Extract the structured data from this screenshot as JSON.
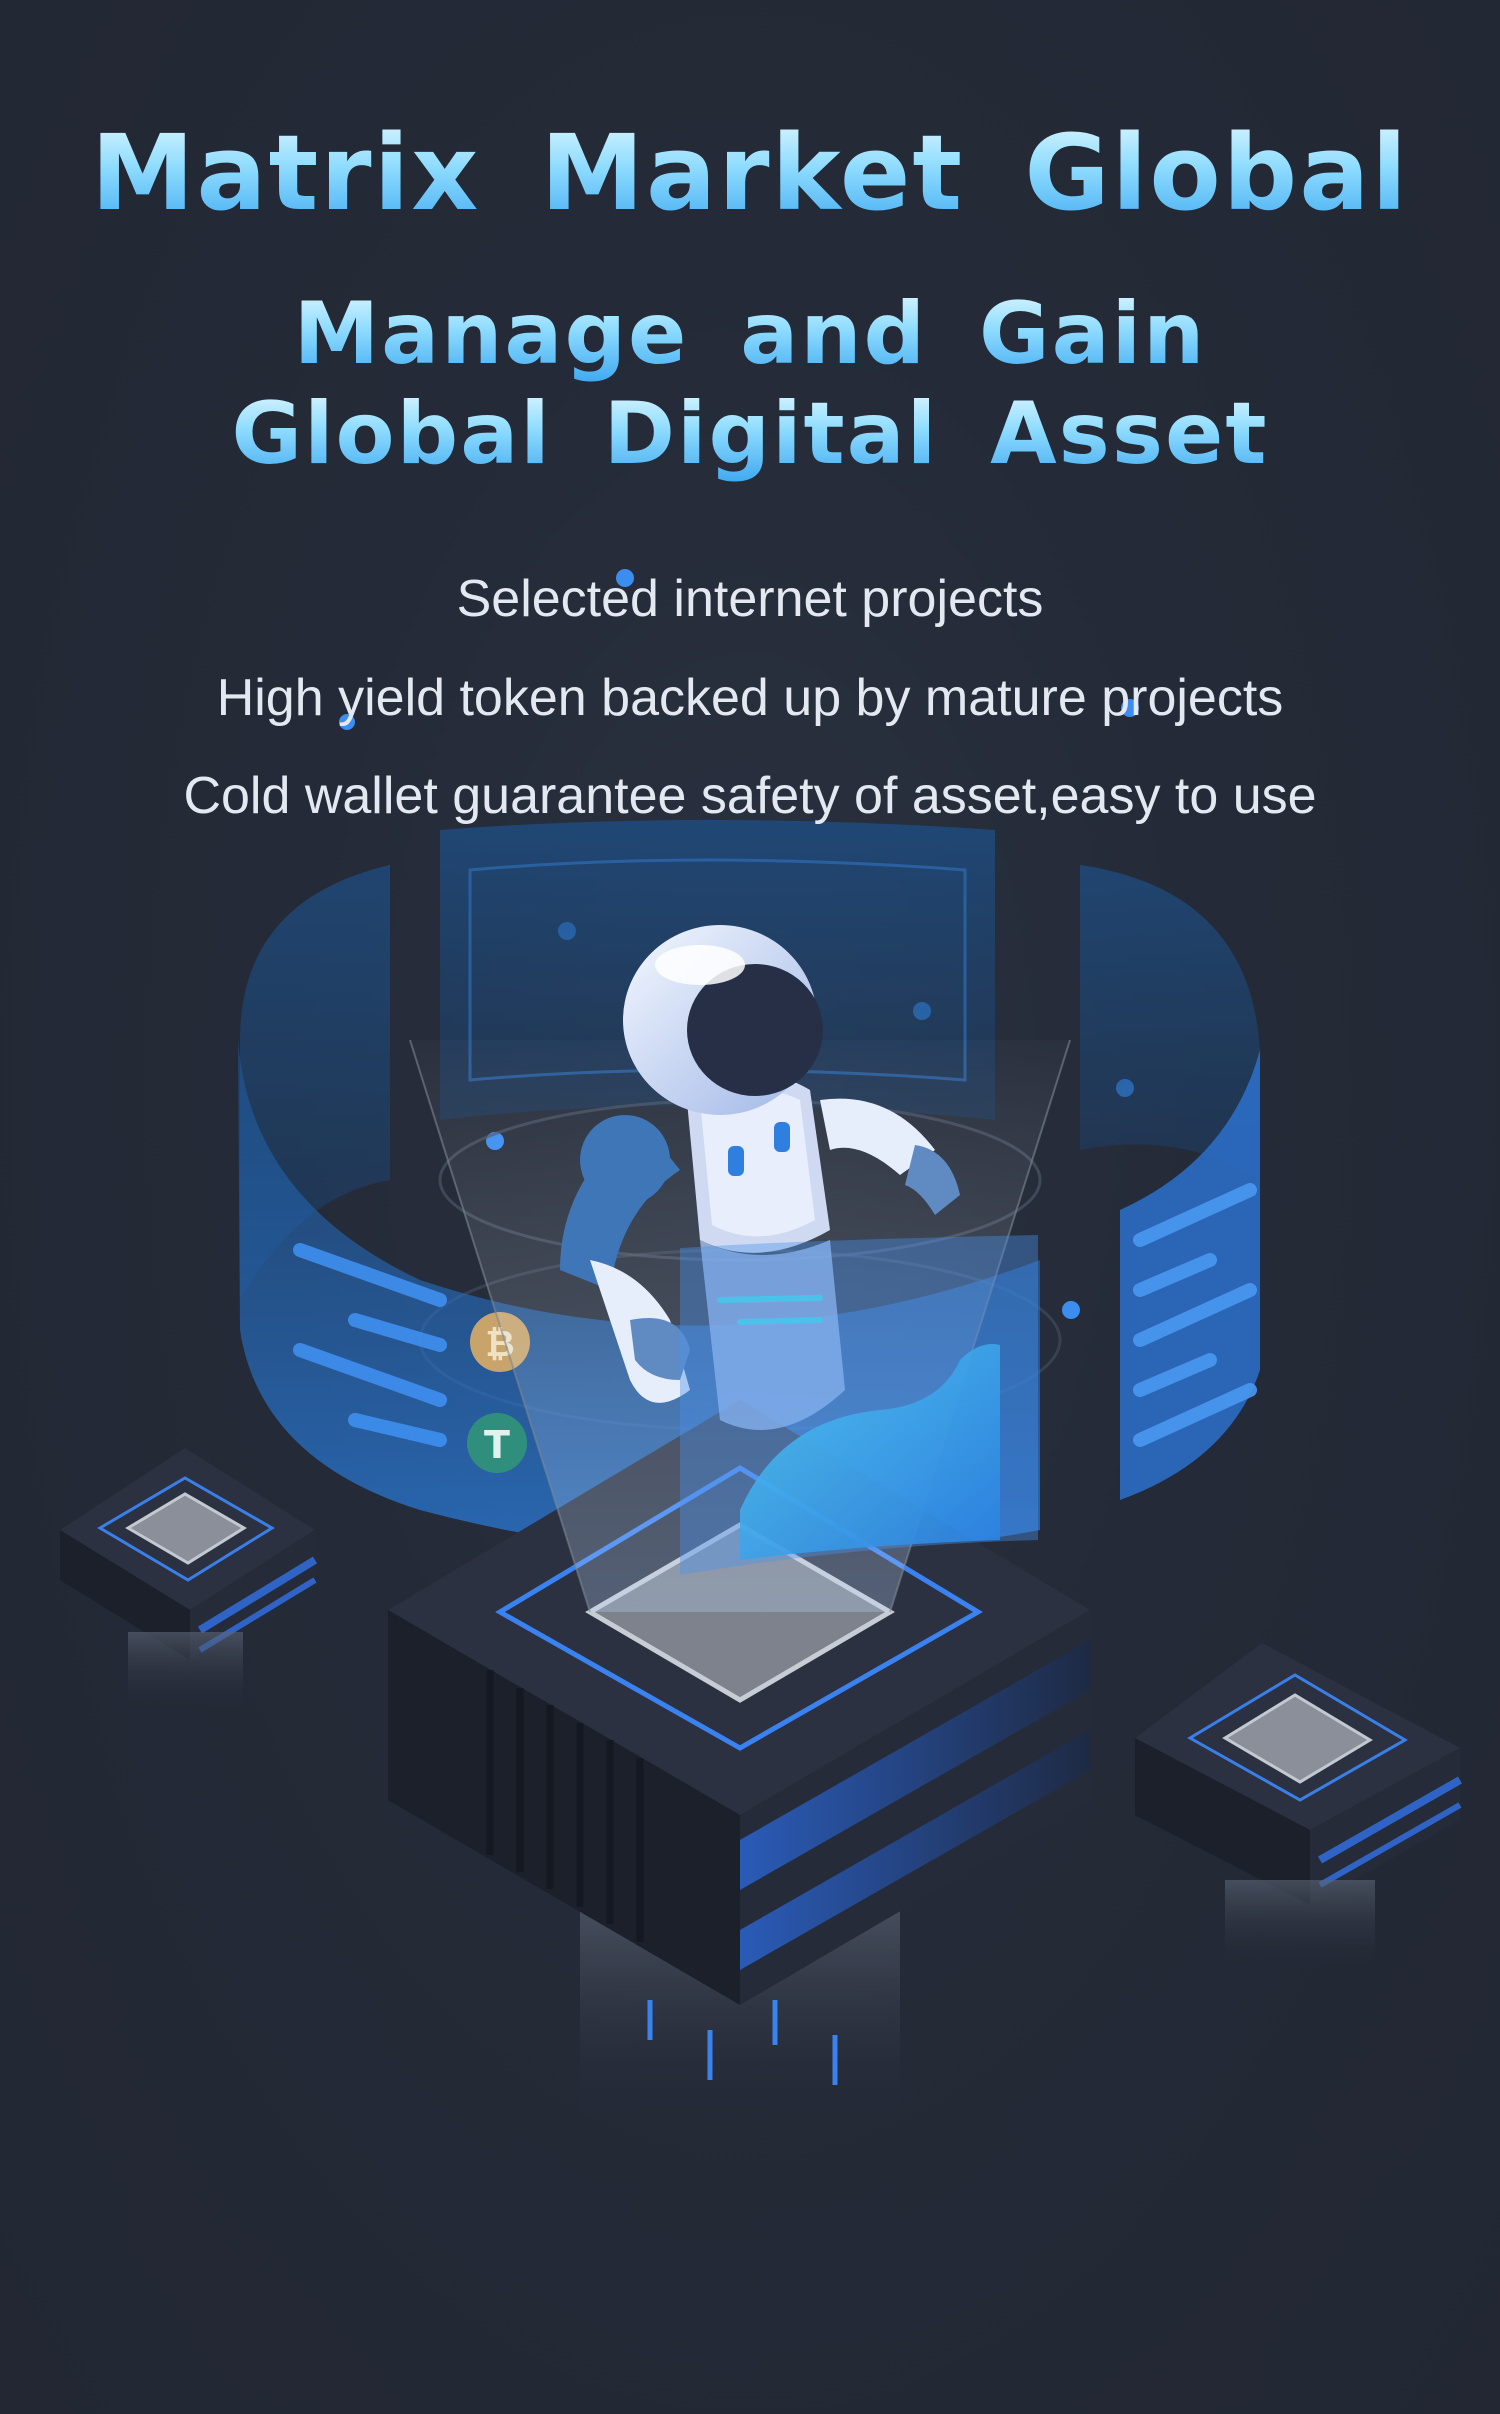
{
  "header": {
    "title": "Matrix Market Global",
    "subtitle_line_1": "Manage and Gain",
    "subtitle_line_2": "Global Digital Asset"
  },
  "features": [
    "Selected internet projects",
    "High yield token backed up by mature projects",
    "Cold wallet guarantee safety of asset,easy to use"
  ],
  "illustration": {
    "icons": [
      "robot-icon",
      "bitcoin-icon",
      "tether-icon",
      "server-platform-icon",
      "chip-icon"
    ],
    "colors": {
      "background": "#232835",
      "accent": "#3a8ef0",
      "title_gradient_top": "#e9fbff",
      "title_gradient_bottom": "#3aa6ef",
      "bitcoin": "#c9a46a",
      "tether": "#2f8f7c"
    }
  }
}
